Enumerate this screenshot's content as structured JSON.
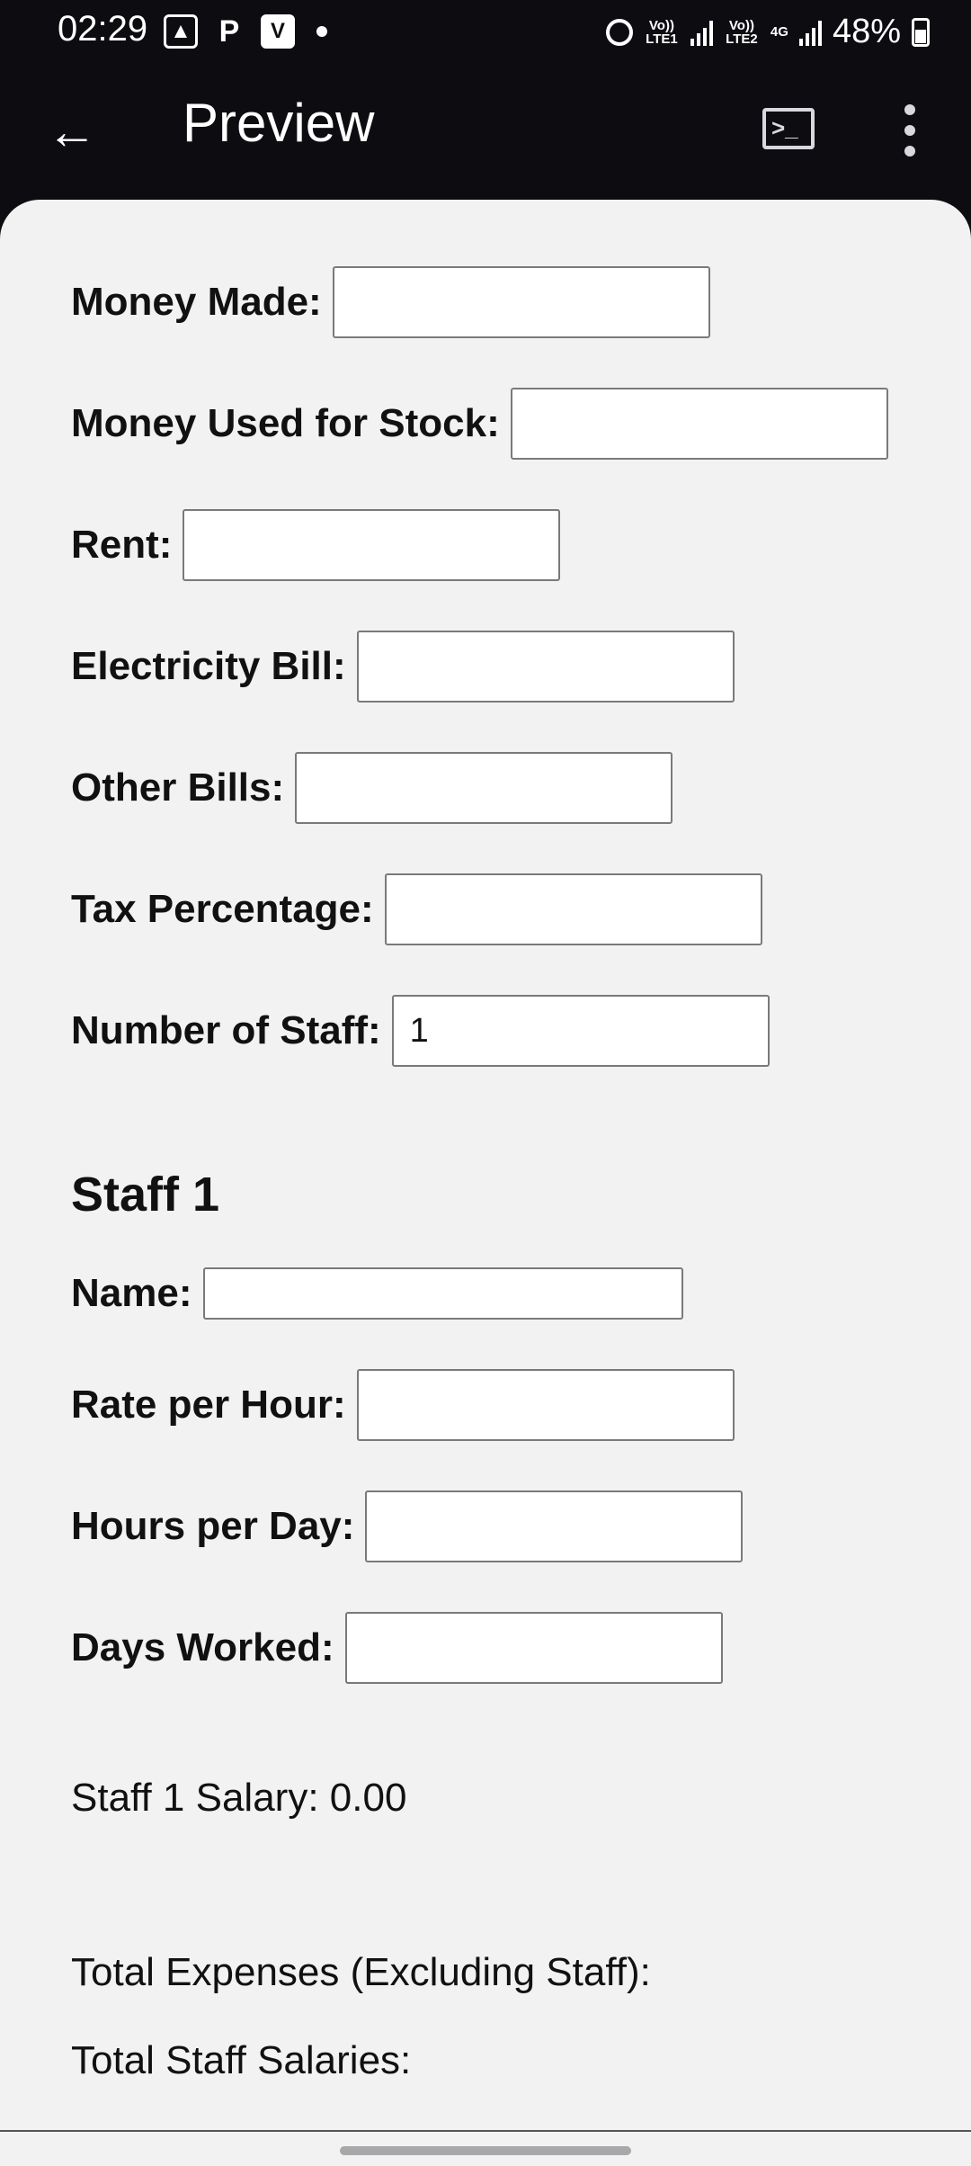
{
  "status_bar": {
    "time": "02:29",
    "left_icons": [
      "gallery-icon",
      "p-icon",
      "v-icon"
    ],
    "sim1": "Vo)) LTE1",
    "sim2": "Vo)) LTE2",
    "network": "4G",
    "battery": "48%",
    "battery_level": 0.48
  },
  "app_bar": {
    "title": "Preview",
    "console_glyph": ">_"
  },
  "form": {
    "fields": [
      {
        "label": "Money Made:",
        "value": ""
      },
      {
        "label": "Money Used for Stock:",
        "value": ""
      },
      {
        "label": "Rent:",
        "value": ""
      },
      {
        "label": "Electricity Bill:",
        "value": ""
      },
      {
        "label": "Other Bills:",
        "value": ""
      },
      {
        "label": "Tax Percentage:",
        "value": ""
      },
      {
        "label": "Number of Staff:",
        "value": "1"
      }
    ]
  },
  "staff": {
    "title": "Staff 1",
    "fields": [
      {
        "label": "Name:",
        "value": ""
      },
      {
        "label": "Rate per Hour:",
        "value": ""
      },
      {
        "label": "Hours per Day:",
        "value": ""
      },
      {
        "label": "Days Worked:",
        "value": ""
      }
    ],
    "salary_text": "Staff 1 Salary: 0.00"
  },
  "totals": {
    "expenses_label": "Total Expenses (Excluding Staff):",
    "salaries_label": "Total Staff Salaries:"
  }
}
